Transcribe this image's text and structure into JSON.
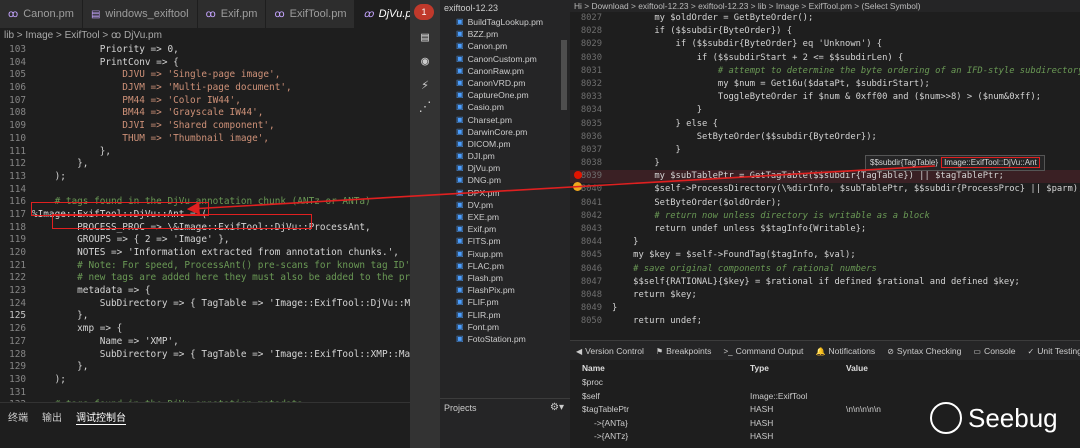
{
  "left_editor": {
    "tabs": [
      {
        "label": "Canon.pm",
        "active": false
      },
      {
        "label": "windows_exiftool",
        "active": false
      },
      {
        "label": "Exif.pm",
        "active": false
      },
      {
        "label": "ExifTool.pm",
        "active": false
      },
      {
        "label": "DjVu.pm",
        "active": true
      }
    ],
    "tab_close": "×",
    "breadcrumb": "lib > Image > ExifTool > ꝏ DjVu.pm",
    "lines": [
      {
        "n": "103",
        "t": "            Priority => 0,",
        "c": ""
      },
      {
        "n": "104",
        "t": "            PrintConv => {",
        "c": ""
      },
      {
        "n": "105",
        "t": "                DJVU => 'Single-page image',",
        "c": "str"
      },
      {
        "n": "106",
        "t": "                DJVM => 'Multi-page document',",
        "c": "str"
      },
      {
        "n": "107",
        "t": "                PM44 => 'Color IW44',",
        "c": "str"
      },
      {
        "n": "108",
        "t": "                BM44 => 'Grayscale IW44',",
        "c": "str"
      },
      {
        "n": "109",
        "t": "                DJVI => 'Shared component',",
        "c": "str"
      },
      {
        "n": "110",
        "t": "                THUM => 'Thumbnail image',",
        "c": "str"
      },
      {
        "n": "111",
        "t": "            },",
        "c": ""
      },
      {
        "n": "112",
        "t": "        },",
        "c": ""
      },
      {
        "n": "113",
        "t": "    );",
        "c": ""
      },
      {
        "n": "114",
        "t": "",
        "c": ""
      },
      {
        "n": "116",
        "t": "    # tags found in the DjVu annotation chunk (ANTz or ANTa)",
        "c": "com"
      },
      {
        "n": "117",
        "t": "%Image::ExifTool::DjVu::Ant = (",
        "c": ""
      },
      {
        "n": "118",
        "t": "        PROCESS_PROC => \\&Image::ExifTool::DjVu::ProcessAnt,",
        "c": ""
      },
      {
        "n": "119",
        "t": "        GROUPS => { 2 => 'Image' },",
        "c": ""
      },
      {
        "n": "120",
        "t": "        NOTES => 'Information extracted from annotation chunks.',",
        "c": ""
      },
      {
        "n": "121",
        "t": "        # Note: For speed, ProcessAnt() pre-scans for known tag ID's, so if any",
        "c": "com"
      },
      {
        "n": "122",
        "t": "        # new tags are added here they must also be added to the pre-scan check",
        "c": "com"
      },
      {
        "n": "123",
        "t": "        metadata => {",
        "c": ""
      },
      {
        "n": "124",
        "t": "            SubDirectory => { TagTable => 'Image::ExifTool::DjVu::Meta' }",
        "c": ""
      },
      {
        "n": "125",
        "t": "        },",
        "c": ""
      },
      {
        "n": "126",
        "t": "        xmp => {",
        "c": ""
      },
      {
        "n": "127",
        "t": "            Name => 'XMP',",
        "c": ""
      },
      {
        "n": "128",
        "t": "            SubDirectory => { TagTable => 'Image::ExifTool::XMP::Main' }",
        "c": ""
      },
      {
        "n": "129",
        "t": "        },",
        "c": ""
      },
      {
        "n": "130",
        "t": "    );",
        "c": ""
      },
      {
        "n": "131",
        "t": "",
        "c": ""
      },
      {
        "n": "132",
        "t": "    # tags found in the DjVu annotation metadata",
        "c": "com"
      }
    ]
  },
  "bottom_panel": {
    "tabs": [
      "终端",
      "输出",
      "调试控制台"
    ],
    "active": "调试控制台"
  },
  "activity_bar": {
    "badge": "1"
  },
  "file_tree": {
    "header": "exiftool-12.23",
    "files": [
      "BuildTagLookup.pm",
      "BZZ.pm",
      "Canon.pm",
      "CanonCustom.pm",
      "CanonRaw.pm",
      "CanonVRD.pm",
      "CaptureOne.pm",
      "Casio.pm",
      "Charset.pm",
      "DarwinCore.pm",
      "DICOM.pm",
      "DJI.pm",
      "DjVu.pm",
      "DNG.pm",
      "DPX.pm",
      "DV.pm",
      "EXE.pm",
      "Exif.pm",
      "FITS.pm",
      "Fixup.pm",
      "FLAC.pm",
      "Flash.pm",
      "FlashPix.pm",
      "FLIF.pm",
      "FLIR.pm",
      "Font.pm",
      "FotoStation.pm"
    ],
    "projects_label": "Projects"
  },
  "right_editor": {
    "breadcrumb": "Hi > Download > exiftool-12.23 > exiftool-12.23 > lib > Image > ExifTool.pm > (Select Symbol)",
    "lines": [
      {
        "n": "8027",
        "t": "        my $oldOrder = GetByteOrder();",
        "c": ""
      },
      {
        "n": "8028",
        "t": "        if ($$subdir{ByteOrder}) {",
        "c": ""
      },
      {
        "n": "8029",
        "t": "            if ($$subdir{ByteOrder} eq 'Unknown') {",
        "c": ""
      },
      {
        "n": "8030",
        "t": "                if ($$subdirStart + 2 <= $$subdirLen) {",
        "c": ""
      },
      {
        "n": "8031",
        "t": "                    # attempt to determine the byte ordering of an IFD-style subdirectory",
        "c": "com"
      },
      {
        "n": "8032",
        "t": "                    my $num = Get16u($dataPt, $subdirStart);",
        "c": ""
      },
      {
        "n": "8033",
        "t": "                    ToggleByteOrder if $num & 0xff00 and ($num>>8) > ($num&0xff);",
        "c": ""
      },
      {
        "n": "8034",
        "t": "                }",
        "c": ""
      },
      {
        "n": "8035",
        "t": "            } else {",
        "c": ""
      },
      {
        "n": "8036",
        "t": "                SetByteOrder($$subdir{ByteOrder});",
        "c": ""
      },
      {
        "n": "8037",
        "t": "            }",
        "c": ""
      },
      {
        "n": "8038",
        "t": "        }",
        "c": ""
      },
      {
        "n": "8039",
        "t": "        my $subTablePtr = GetTagTable($$subdir{TagTable}) || $tagTablePtr;",
        "c": "",
        "hl": true
      },
      {
        "n": "8040",
        "t": "        $self->ProcessDirectory(\\%dirInfo, $subTablePtr, $$subdir{ProcessProc} || $parm);",
        "c": ""
      },
      {
        "n": "8041",
        "t": "        SetByteOrder($oldOrder);",
        "c": ""
      },
      {
        "n": "8042",
        "t": "        # return now unless directory is writable as a block",
        "c": "com"
      },
      {
        "n": "8043",
        "t": "        return undef unless $$tagInfo{Writable};",
        "c": ""
      },
      {
        "n": "8044",
        "t": "    }",
        "c": ""
      },
      {
        "n": "8045",
        "t": "    my $key = $self->FoundTag($tagInfo, $val);",
        "c": ""
      },
      {
        "n": "8046",
        "t": "    # save original components of rational numbers",
        "c": "com"
      },
      {
        "n": "8047",
        "t": "    $$self{RATIONAL}{$key} = $rational if defined $rational and defined $key;",
        "c": ""
      },
      {
        "n": "8048",
        "t": "    return $key;",
        "c": ""
      },
      {
        "n": "8049",
        "t": "}",
        "c": ""
      },
      {
        "n": "8050",
        "t": "    return undef;",
        "c": ""
      },
      {
        "n": "8051",
        "t": "}",
        "c": ""
      }
    ]
  },
  "tooltip": {
    "expr": "$$subdir{TagTable}",
    "value": "Image::ExifTool::DjVu::Ant"
  },
  "debug_tabs": [
    {
      "label": "Version Control",
      "icon": "◀"
    },
    {
      "label": "Breakpoints",
      "icon": "⚑"
    },
    {
      "label": "Command Output",
      "icon": ">_"
    },
    {
      "label": "Notifications",
      "icon": "🔔"
    },
    {
      "label": "Syntax Checking",
      "icon": "⊘"
    },
    {
      "label": "Console",
      "icon": "▭"
    },
    {
      "label": "Unit Testing",
      "icon": "✓"
    },
    {
      "label": "Deb",
      "icon": "▶"
    }
  ],
  "variables": {
    "headers": [
      "Name",
      "Type",
      "Value"
    ],
    "rows": [
      {
        "name": "$proc",
        "type": "",
        "value": ""
      },
      {
        "name": "$self",
        "type": "Image::ExifTool",
        "value": ""
      },
      {
        "name": "$tagTablePtr",
        "type": "HASH",
        "value": "\\n\\n\\n\\n\\n"
      },
      {
        "name": "->{ANTa}",
        "type": "HASH",
        "value": ""
      },
      {
        "name": "->{ANTz}",
        "type": "HASH",
        "value": ""
      }
    ]
  },
  "watermark": {
    "text": "Seebug"
  },
  "colors": {
    "highlight": "#e02020",
    "breakpoint": "#e51400",
    "accent": "#0e639c"
  }
}
